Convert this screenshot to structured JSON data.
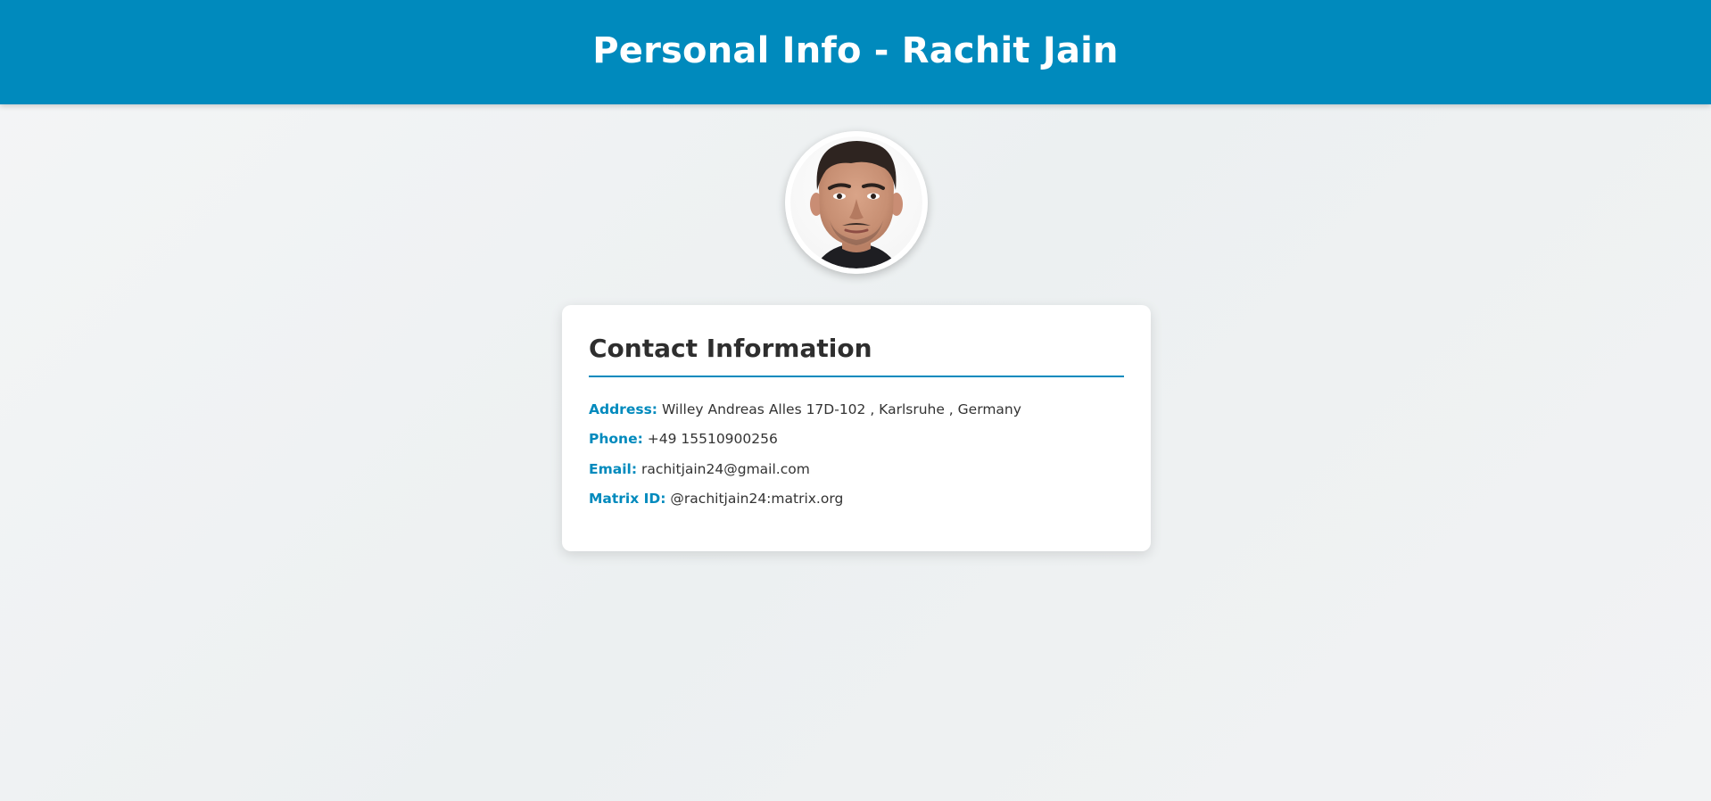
{
  "page": {
    "title": "Personal Info - Rachit Jain"
  },
  "colors": {
    "header_bg": "#008abd",
    "accent": "#008abd",
    "heading_text": "#2e2e2e",
    "body_text": "#333333"
  },
  "profile": {
    "photo_icon": "profile-photo"
  },
  "contact": {
    "heading": "Contact Information",
    "items": [
      {
        "label": "Address:",
        "value": "Willey Andreas Alles 17D-102 , Karlsruhe , Germany"
      },
      {
        "label": "Phone:",
        "value": "+49 15510900256"
      },
      {
        "label": "Email:",
        "value": "rachitjain24@gmail.com"
      },
      {
        "label": "Matrix ID:",
        "value": "@rachitjain24:matrix.org"
      }
    ]
  }
}
